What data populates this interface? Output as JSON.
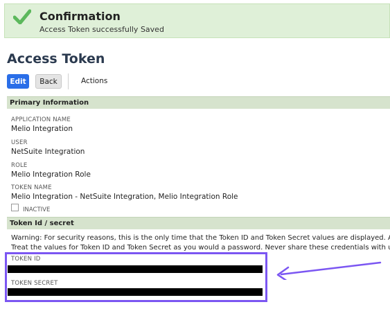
{
  "confirmation": {
    "title": "Confirmation",
    "message": "Access Token successfully Saved",
    "icon": "check-icon",
    "color": "#dff0d8"
  },
  "page": {
    "title": "Access Token"
  },
  "toolbar": {
    "edit_label": "Edit",
    "back_label": "Back",
    "actions_label": "Actions"
  },
  "primary": {
    "header": "Primary Information",
    "application_name": {
      "label": "APPLICATION NAME",
      "value": "Melio Integration"
    },
    "user": {
      "label": "USER",
      "value": "NetSuite Integration"
    },
    "role": {
      "label": "ROLE",
      "value": "Melio Integration Role"
    },
    "token_name": {
      "label": "TOKEN NAME",
      "value": "Melio Integration - NetSuite Integration, Melio Integration Role"
    },
    "inactive": {
      "label": "INACTIVE",
      "checked": false
    }
  },
  "secret": {
    "header": "Token Id / secret",
    "warning_line1": "Warning: For security reasons, this is the only time that the Token ID and Token Secret values are displayed. After you",
    "warning_line2": "Treat the values for Token ID and Token Secret as you would a password. Never share these credentials with unauthor",
    "token_id": {
      "label": "TOKEN ID"
    },
    "token_secret": {
      "label": "TOKEN SECRET"
    }
  },
  "annotation": {
    "color": "#7b56f2"
  }
}
